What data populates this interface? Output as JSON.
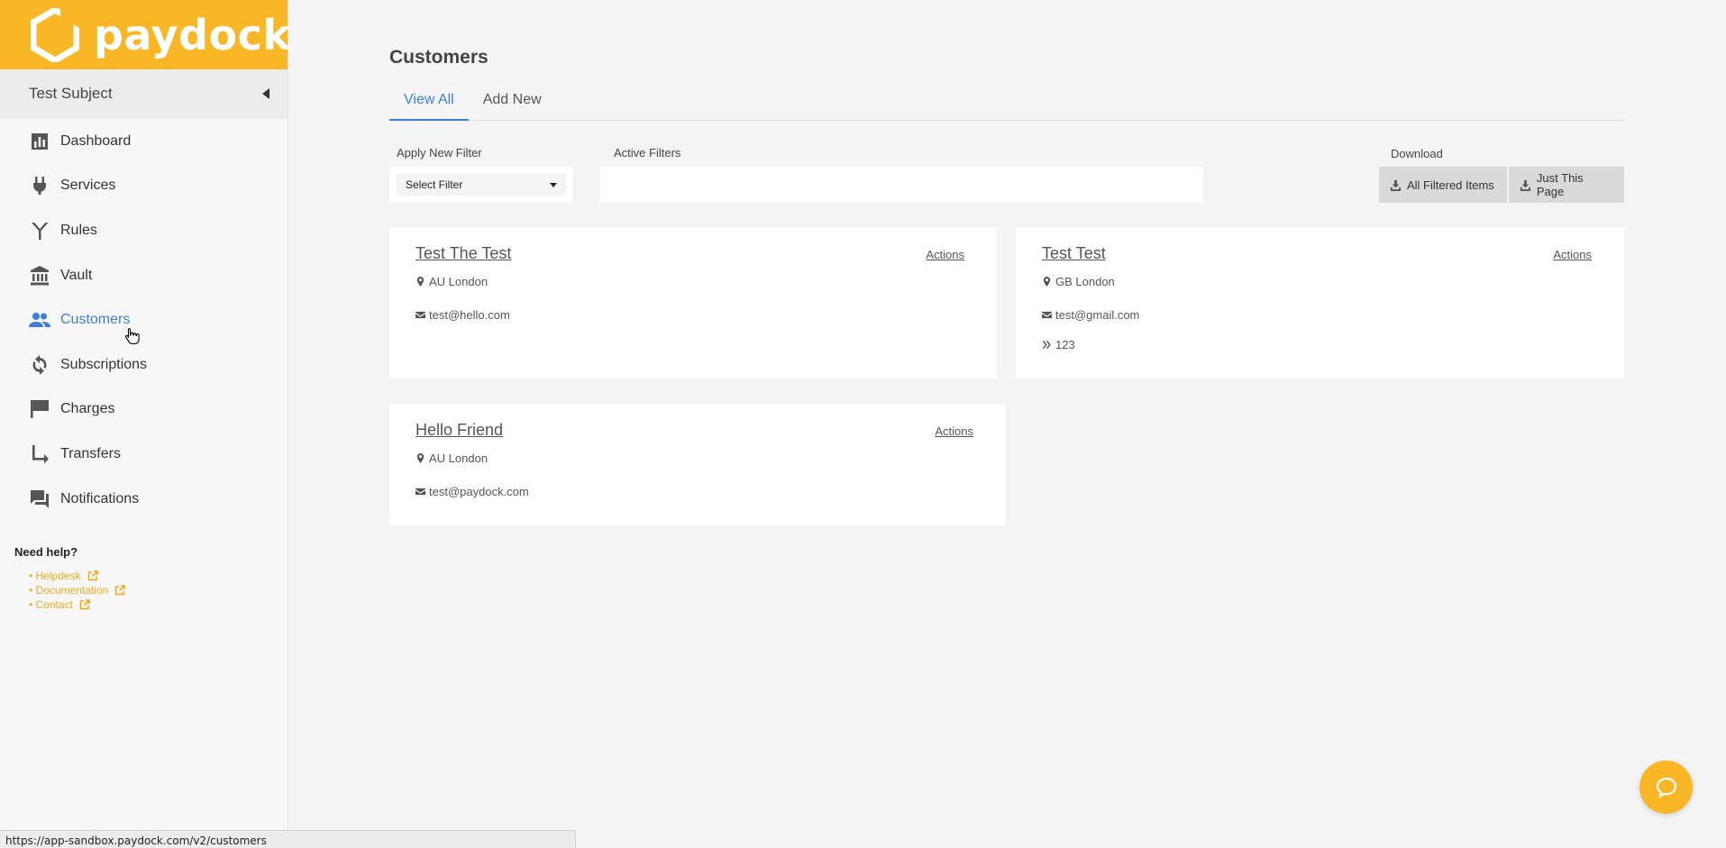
{
  "brand": {
    "name": "paydock",
    "color": "#f9b625"
  },
  "account": {
    "name": "Test Subject"
  },
  "nav": [
    {
      "label": "Dashboard",
      "icon": "bar-chart-icon",
      "active": false
    },
    {
      "label": "Services",
      "icon": "plug-icon",
      "active": false
    },
    {
      "label": "Rules",
      "icon": "fork-icon",
      "active": false
    },
    {
      "label": "Vault",
      "icon": "bank-icon",
      "active": false
    },
    {
      "label": "Customers",
      "icon": "people-icon",
      "active": true
    },
    {
      "label": "Subscriptions",
      "icon": "refresh-icon",
      "active": false
    },
    {
      "label": "Charges",
      "icon": "flag-icon",
      "active": false
    },
    {
      "label": "Transfers",
      "icon": "turn-right-arrow-icon",
      "active": false
    },
    {
      "label": "Notifications",
      "icon": "chat-bubbles-icon",
      "active": false
    }
  ],
  "help": {
    "title": "Need help?",
    "links": [
      "• Helpdesk",
      "• Documentation",
      "• Contact"
    ]
  },
  "page": {
    "title": "Customers",
    "tabs": [
      {
        "label": "View All",
        "active": true
      },
      {
        "label": "Add New",
        "active": false
      }
    ]
  },
  "filters": {
    "apply_label": "Apply New Filter",
    "select_value": "Select Filter",
    "active_label": "Active Filters",
    "download_label": "Download",
    "all_filtered_label": "All Filtered Items",
    "this_page_label": "Just This Page"
  },
  "customers": [
    {
      "name": "Test The Test",
      "location": "AU London",
      "email": "test@hello.com",
      "reference": null,
      "actions_label": "Actions"
    },
    {
      "name": "Test Test",
      "location": "GB London",
      "email": "test@gmail.com",
      "reference": "123",
      "actions_label": "Actions"
    },
    {
      "name": "Hello Friend",
      "location": "AU London",
      "email": "test@paydock.com",
      "reference": null,
      "actions_label": "Actions"
    }
  ],
  "status_url": "https://app-sandbox.paydock.com/v2/customers",
  "colors": {
    "accent": "#3d7fd6",
    "link": "#f0a91a"
  }
}
